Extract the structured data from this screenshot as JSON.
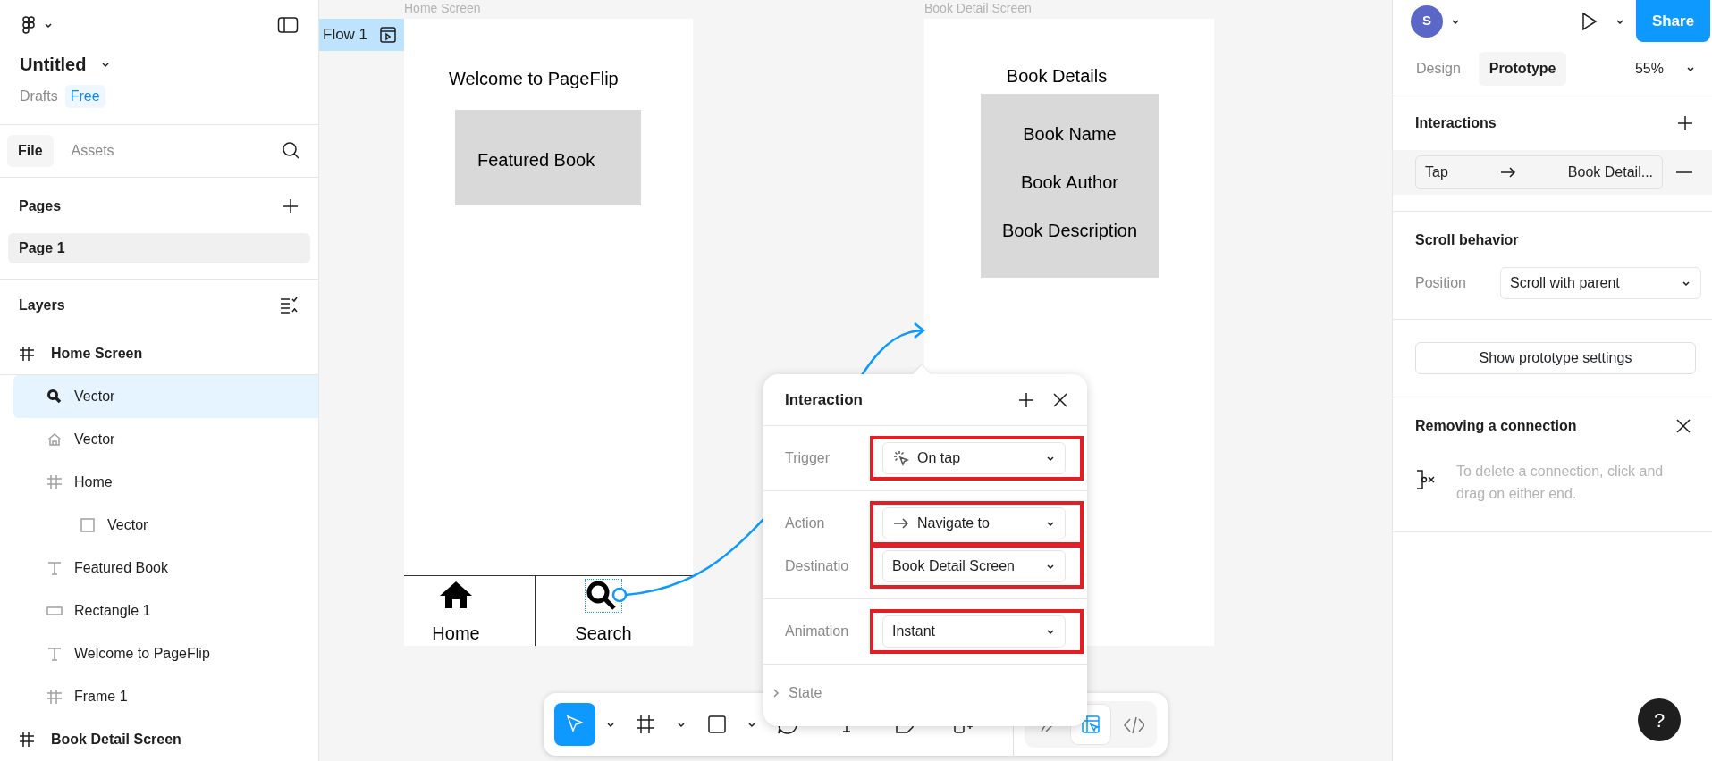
{
  "file_menu": {
    "title": "Untitled",
    "location": "Drafts",
    "plan": "Free"
  },
  "left_tabs": [
    {
      "label": "File",
      "selected": true
    },
    {
      "label": "Assets",
      "selected": false
    }
  ],
  "pages": {
    "title": "Pages",
    "items": [
      {
        "label": "Page 1",
        "selected": true
      }
    ]
  },
  "layers": {
    "title": "Layers",
    "items": [
      {
        "label": "Home Screen",
        "kind": "frame",
        "selected": false,
        "children": [
          {
            "label": "Vector",
            "kind": "search",
            "selected": true
          },
          {
            "label": "Vector",
            "kind": "home",
            "selected": false
          },
          {
            "label": "Home",
            "kind": "frame",
            "selected": false,
            "children": [
              {
                "label": "Vector",
                "kind": "square",
                "selected": false
              }
            ]
          },
          {
            "label": "Featured Book",
            "kind": "text",
            "selected": false
          },
          {
            "label": "Rectangle 1",
            "kind": "rectangle",
            "selected": false
          },
          {
            "label": "Welcome to PageFlip",
            "kind": "text",
            "selected": false
          },
          {
            "label": "Frame 1",
            "kind": "frame",
            "selected": false
          }
        ]
      },
      {
        "label": "Book Detail Screen",
        "kind": "frame",
        "selected": false
      }
    ]
  },
  "canvas": {
    "flow": "Flow 1",
    "home_screen": {
      "label": "Home Screen",
      "title": "Welcome to PageFlip",
      "featured": "Featured Book",
      "nav": [
        {
          "kind": "home",
          "label": "Home",
          "selected": false
        },
        {
          "kind": "search",
          "label": "Search",
          "selected": true
        }
      ]
    },
    "detail_screen": {
      "label": "Book Detail Screen",
      "title": "Book Details",
      "lines": [
        "Book Name",
        "Book Author",
        "Book Description"
      ]
    }
  },
  "interaction_popup": {
    "title": "Interaction",
    "sections": [
      {
        "fields": [
          {
            "label": "Trigger",
            "value": "On tap",
            "kind": "tap",
            "highlighted": true
          }
        ]
      },
      {
        "fields": [
          {
            "label": "Action",
            "value": "Navigate to",
            "kind": "arrow",
            "highlighted": true
          },
          {
            "label": "Destinatio",
            "value": "Book Detail Screen",
            "highlighted": true
          }
        ]
      },
      {
        "fields": [
          {
            "label": "Animation",
            "value": "Instant",
            "highlighted": true
          }
        ]
      }
    ],
    "state": {
      "label": "State",
      "expanded": false
    }
  },
  "toolbar": {
    "tools": [
      {
        "kind": "move",
        "selected": true,
        "menu": true
      },
      {
        "kind": "frame",
        "selected": false,
        "menu": true
      },
      {
        "kind": "shape",
        "selected": false,
        "menu": true
      },
      {
        "kind": "comment",
        "selected": false
      },
      {
        "kind": "text",
        "selected": false
      },
      {
        "kind": "sticky",
        "selected": false
      },
      {
        "kind": "widget",
        "selected": false
      }
    ],
    "modes": [
      {
        "kind": "draw",
        "selected": false
      },
      {
        "kind": "prototype",
        "selected": true
      },
      {
        "kind": "code",
        "selected": false
      }
    ]
  },
  "right_panel": {
    "user": "S",
    "share": "Share",
    "tabs": [
      {
        "label": "Design",
        "selected": false
      },
      {
        "label": "Prototype",
        "selected": true
      }
    ],
    "zoom": "55%",
    "interactions": {
      "title": "Interactions",
      "items": [
        {
          "trigger": "Tap",
          "destination": "Book Detail..."
        }
      ]
    },
    "scroll": {
      "title": "Scroll behavior",
      "label": "Position",
      "value": "Scroll with parent"
    },
    "settings_button": "Show prototype settings",
    "tip": {
      "title": "Removing a connection",
      "text": "To delete a connection, click and drag on either end."
    }
  },
  "help": "?"
}
